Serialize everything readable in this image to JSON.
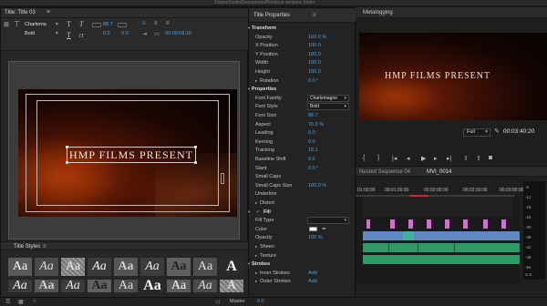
{
  "os_title": "/Users/Justin/Documents/Previous versions folder",
  "title_window": {
    "tab_label": "Title: Title 03",
    "menu_glyph": "≡",
    "toolbar": {
      "font_family": "Charlema",
      "font_style": "Bold",
      "font_size": "88.7",
      "kerning": "0.0",
      "leading": "0.0",
      "timecode": "00:00:09:10"
    },
    "canvas_text": "HMP FILMS PRESENT"
  },
  "title_styles": {
    "header": "Title Styles",
    "samples": [
      "Aa",
      "Aa",
      "Aa",
      "Aa",
      "Aa",
      "Aa",
      "Aa",
      "Aa",
      "A"
    ]
  },
  "title_properties": {
    "header": "Title Properties",
    "rows": [
      {
        "kind": "sec",
        "label": "Transform",
        "value": ""
      },
      {
        "kind": "row",
        "label": "Opacity",
        "value": "100.0 %"
      },
      {
        "kind": "row",
        "label": "X Position",
        "value": "100.0"
      },
      {
        "kind": "row",
        "label": "Y Position",
        "value": "100.0"
      },
      {
        "kind": "row",
        "label": "Width",
        "value": "100.0"
      },
      {
        "kind": "row",
        "label": "Height",
        "value": "100.0"
      },
      {
        "kind": "sub",
        "label": "Rotation",
        "value": "0.0 °"
      },
      {
        "kind": "sec",
        "label": "Properties",
        "value": ""
      },
      {
        "kind": "dd",
        "label": "Font Family",
        "value": "Charlemagne"
      },
      {
        "kind": "dd",
        "label": "Font Style",
        "value": "Bold"
      },
      {
        "kind": "row",
        "label": "Font Size",
        "value": "88.7"
      },
      {
        "kind": "row",
        "label": "Aspect",
        "value": "76.3 %"
      },
      {
        "kind": "row",
        "label": "Leading",
        "value": "0.0"
      },
      {
        "kind": "row",
        "label": "Kerning",
        "value": "0.0"
      },
      {
        "kind": "row",
        "label": "Tracking",
        "value": "18.1"
      },
      {
        "kind": "row",
        "label": "Baseline Shift",
        "value": "0.0"
      },
      {
        "kind": "row",
        "label": "Slant",
        "value": "0.0 °"
      },
      {
        "kind": "row",
        "label": "Small Caps",
        "value": ""
      },
      {
        "kind": "row",
        "label": "Small Caps Size",
        "value": "100.0 %"
      },
      {
        "kind": "row",
        "label": "Underline",
        "value": ""
      },
      {
        "kind": "sub",
        "label": "Distort",
        "value": ""
      },
      {
        "kind": "sec",
        "label": "Fill",
        "value": ""
      },
      {
        "kind": "dd",
        "label": "Fill Type",
        "value": ""
      },
      {
        "kind": "row",
        "label": "Color",
        "value": ""
      },
      {
        "kind": "row",
        "label": "Opacity",
        "value": "100 %"
      },
      {
        "kind": "sub",
        "label": "Sheen",
        "value": ""
      },
      {
        "kind": "sub",
        "label": "Texture",
        "value": ""
      },
      {
        "kind": "sec",
        "label": "Strokes",
        "value": ""
      },
      {
        "kind": "sub",
        "label": "Inner Strokes",
        "value": "Add"
      },
      {
        "kind": "sub",
        "label": "Outer Strokes",
        "value": "Add"
      }
    ]
  },
  "program_monitor": {
    "tab_label": "Metalogging",
    "frame_text": "HMP FILMS PRESENT",
    "fit": "Full",
    "timecode": "00:03:40:20"
  },
  "timeline": {
    "tabs": [
      "Nested Sequence 04",
      "MVI_0014"
    ],
    "ruler": [
      "01:00:00",
      "00:01:30:00",
      "00:02:00:00",
      "00:02:30:00",
      "00:03:00:00"
    ],
    "meter_labels": [
      "-6",
      "-12",
      "-18",
      "-24",
      "-30",
      "-36",
      "-42",
      "-48",
      "-54"
    ],
    "meter_foot": "S S"
  },
  "bottom_bar": {
    "master_label": "Master",
    "master_value": "0.0"
  },
  "colors": {
    "accent": "#4aa3e8",
    "clip_pink": "#d36fd3",
    "clip_blue": "#5f87c3",
    "clip_green": "#2e9a64",
    "clip_teal": "#3fb3a0"
  }
}
